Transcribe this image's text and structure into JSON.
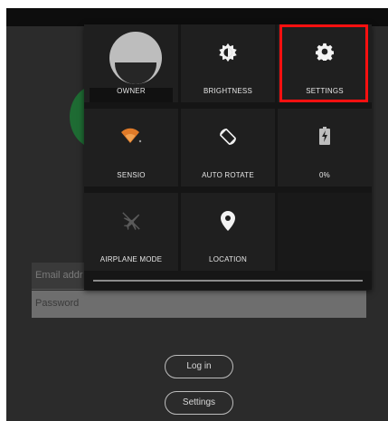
{
  "login": {
    "email_placeholder": "Email addr",
    "password_placeholder": "Password",
    "login_button": "Log in",
    "settings_button": "Settings"
  },
  "quick_settings": {
    "tiles": [
      {
        "label": "OWNER",
        "icon": "owner-avatar-icon"
      },
      {
        "label": "BRIGHTNESS",
        "icon": "brightness-icon"
      },
      {
        "label": "SETTINGS",
        "icon": "gear-icon"
      },
      {
        "label": "SENSIO",
        "icon": "wifi-icon"
      },
      {
        "label": "AUTO ROTATE",
        "icon": "auto-rotate-icon"
      },
      {
        "label": "0%",
        "icon": "battery-charging-icon"
      },
      {
        "label": "AIRPLANE MODE",
        "icon": "airplane-icon"
      },
      {
        "label": "LOCATION",
        "icon": "location-pin-icon"
      }
    ]
  },
  "colors": {
    "highlight": "#ff1010",
    "wifi_accent": "#e07a28",
    "background": "#2b2b2b",
    "panel": "#1f1f1f"
  }
}
